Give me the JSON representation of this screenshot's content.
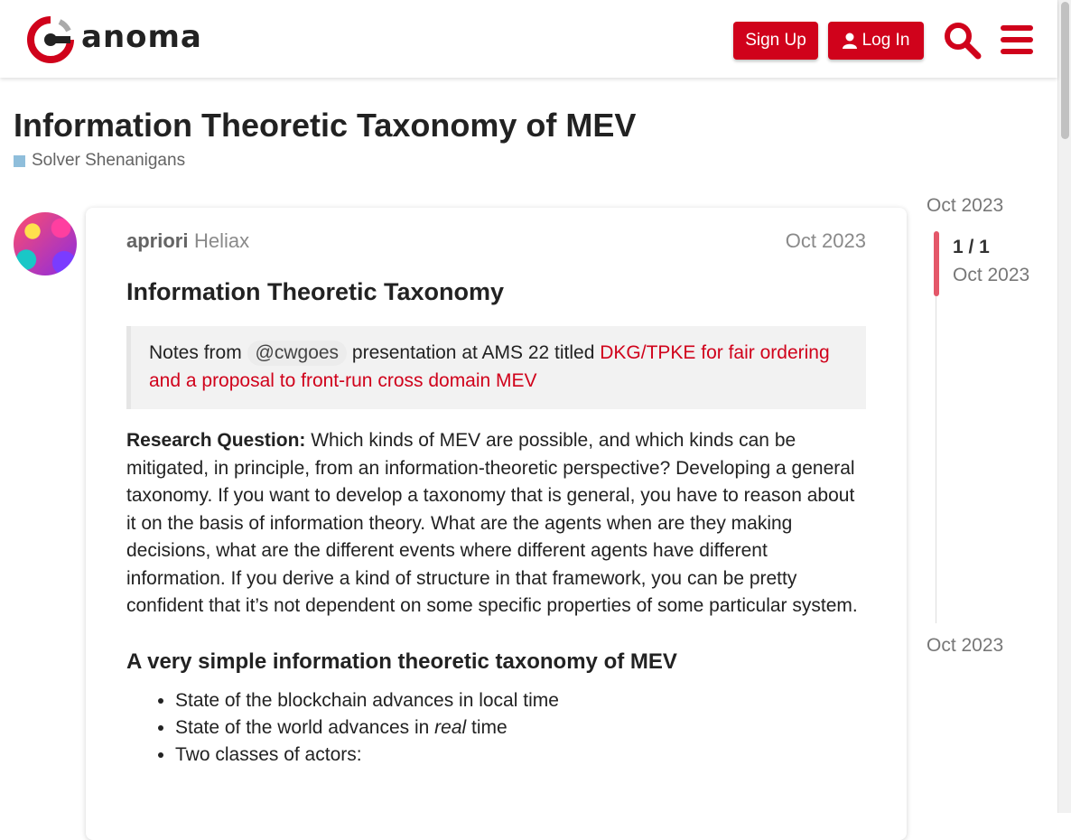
{
  "header": {
    "brand": "anoma",
    "signup_label": "Sign Up",
    "login_label": "Log In"
  },
  "topic": {
    "title": "Information Theoretic Taxonomy of MEV",
    "category": "Solver Shenanigans"
  },
  "post": {
    "username": "apriori",
    "usergroup": "Heliax",
    "date": "Oct 2023",
    "heading": "Information Theoretic Taxonomy",
    "quote": {
      "prefix": "Notes from ",
      "mention": "@cwgoes",
      "middle": " presentation at AMS 22 titled ",
      "link_text": "DKG/TPKE for fair ordering and a proposal to front-run cross domain MEV"
    },
    "research_label": "Research Question:",
    "research_text": " Which kinds of MEV are possible, and which kinds can be mitigated, in principle, from an information-theoretic perspective? Developing a general taxonomy. If you want to develop a taxonomy that is general, you have to reason about it on the basis of information theory. What are the agents when are they making decisions, what are the different events where different agents have different information. If you derive a kind of structure in that framework, you can be pretty confident that it’s not dependent on some specific properties of some particular system.",
    "subheading": "A very simple information theoretic taxonomy of MEV",
    "list": {
      "item1": "State of the blockchain advances in local time",
      "item2_prefix": "State of the world advances in ",
      "item2_em": "real",
      "item2_suffix": " time",
      "item3": "Two classes of actors:"
    }
  },
  "timeline": {
    "start_date": "Oct 2023",
    "position": "1 / 1",
    "current_date": "Oct 2023",
    "end_date": "Oct 2023"
  },
  "colors": {
    "accent": "#d0021b",
    "category_badge": "#8fbedb",
    "timeline_handle": "#e45769"
  }
}
